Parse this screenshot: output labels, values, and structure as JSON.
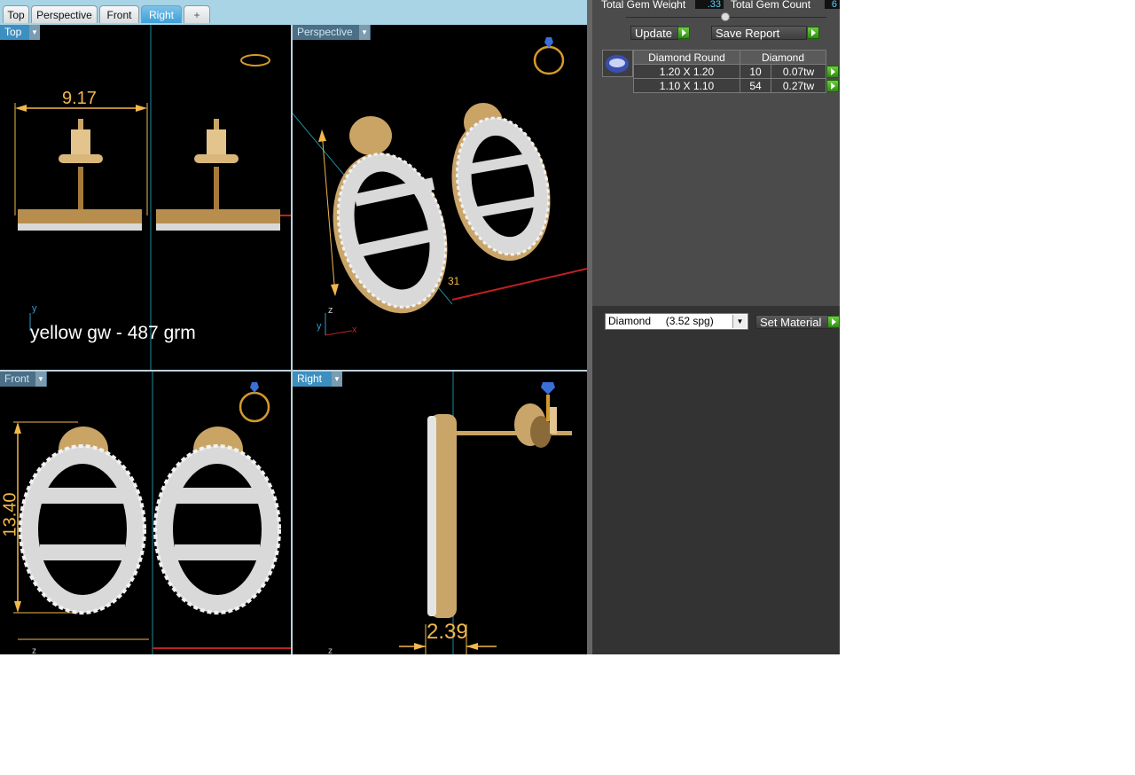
{
  "tabs": [
    {
      "label": "Top"
    },
    {
      "label": "Perspective"
    },
    {
      "label": "Front"
    },
    {
      "label": "Right",
      "active": true
    },
    {
      "label": "+"
    }
  ],
  "viewports": {
    "top": {
      "label": "Top",
      "dimension": "9.17",
      "note": "yellow gw -  487 grm",
      "axis_y": "y"
    },
    "perspective": {
      "label": "Perspective",
      "dimension": "31",
      "axis_x": "x",
      "axis_y": "y",
      "axis_z": "z"
    },
    "front": {
      "label": "Front",
      "dimension": "13.40",
      "axis_z": "z"
    },
    "right": {
      "label": "Right",
      "dimension": "2.39",
      "axis_z": "z"
    }
  },
  "panel": {
    "total_gem_weight_label": "Total Gem Weight",
    "total_gem_weight_value": ".33",
    "total_gem_count_label": "Total Gem Count",
    "total_gem_count_value": "6",
    "update_label": "Update",
    "save_report_label": "Save Report",
    "table_headers": [
      "Diamond Round",
      "Diamond"
    ],
    "rows": [
      {
        "size": "1.20 X 1.20",
        "count": "10",
        "weight": "0.07tw"
      },
      {
        "size": "1.10 X 1.10",
        "count": "54",
        "weight": "0.27tw"
      }
    ],
    "material_select": "Diamond     (3.52 spg)",
    "set_material_label": "Set Material"
  },
  "colors": {
    "tab_bar": "#a8d4e6",
    "viewport_bg": "#000000",
    "dimension": "#f2b84b",
    "gold": "#c9a464",
    "panel_bg": "#4b4b4b",
    "go_button": "#4caf2a"
  }
}
